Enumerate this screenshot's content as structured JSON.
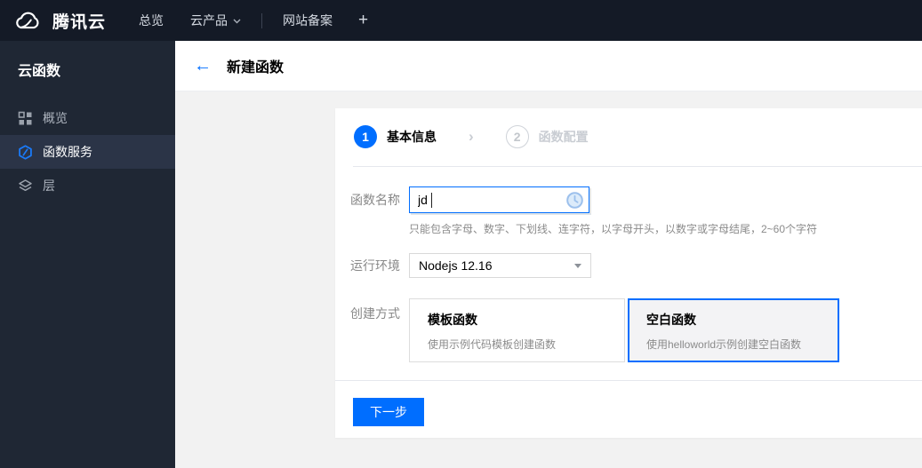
{
  "topbar": {
    "brand": "腾讯云",
    "nav": [
      {
        "label": "总览"
      },
      {
        "label": "云产品",
        "has_dropdown": true
      },
      {
        "label": "网站备案"
      }
    ],
    "add_label": "+"
  },
  "sidebar": {
    "title": "云函数",
    "items": [
      {
        "label": "概览",
        "icon": "grid-icon",
        "active": false
      },
      {
        "label": "函数服务",
        "icon": "function-service-icon",
        "active": true
      },
      {
        "label": "层",
        "icon": "layers-icon",
        "active": false
      }
    ]
  },
  "header": {
    "back_glyph": "←",
    "title": "新建函数"
  },
  "wizard": {
    "separator": "›",
    "steps": [
      {
        "num": "1",
        "label": "基本信息",
        "active": true
      },
      {
        "num": "2",
        "label": "函数配置",
        "active": false
      }
    ]
  },
  "form": {
    "function_name": {
      "label": "函数名称",
      "value": "jd",
      "hint": "只能包含字母、数字、下划线、连字符，以字母开头，以数字或字母结尾，2~60个字符",
      "status_icon": "clock-pending-icon"
    },
    "runtime": {
      "label": "运行环境",
      "value": "Nodejs 12.16"
    },
    "creation_method": {
      "label": "创建方式",
      "options": [
        {
          "title": "模板函数",
          "desc": "使用示例代码模板创建函数",
          "selected": false
        },
        {
          "title": "空白函数",
          "desc": "使用helloworld示例创建空白函数",
          "selected": true
        }
      ]
    }
  },
  "actions": {
    "next_label": "下一步"
  },
  "colors": {
    "accent": "#006eff",
    "topbar_bg": "#141a26",
    "sidebar_bg": "#1f2734",
    "sidebar_active_bg": "#2b3447",
    "page_bg": "#f2f2f2",
    "step_inactive": "#c9cdd3",
    "pending_icon_blue": "#9cc0ec"
  }
}
